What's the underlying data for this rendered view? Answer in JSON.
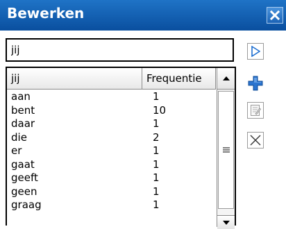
{
  "window": {
    "title": "Bewerken",
    "close_icon": "close-icon"
  },
  "search": {
    "value": "jij"
  },
  "table": {
    "columns": [
      "jij",
      "Frequentie"
    ],
    "rows": [
      {
        "word": "aan",
        "freq": "1"
      },
      {
        "word": "bent",
        "freq": "10"
      },
      {
        "word": "daar",
        "freq": "1"
      },
      {
        "word": "die",
        "freq": "2"
      },
      {
        "word": "er",
        "freq": "1"
      },
      {
        "word": "gaat",
        "freq": "1"
      },
      {
        "word": "geeft",
        "freq": "1"
      },
      {
        "word": "geen",
        "freq": "1"
      },
      {
        "word": "graag",
        "freq": "1"
      }
    ]
  },
  "toolbar": {
    "icons": [
      "play-icon",
      "add-icon",
      "edit-icon",
      "delete-icon"
    ]
  },
  "colors": {
    "title_bar": "#1f73c6",
    "accent": "#1d6ed0"
  }
}
